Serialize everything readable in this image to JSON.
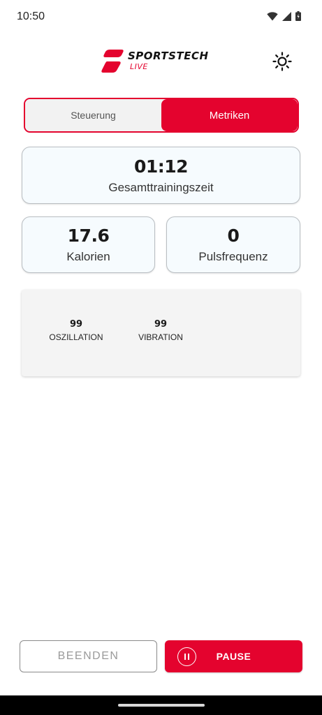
{
  "status_bar": {
    "time": "10:50",
    "icons": [
      "wifi-icon",
      "cell-signal-icon",
      "battery-icon"
    ]
  },
  "header": {
    "brand": "SPORTSTECH",
    "sub": "LIVE",
    "theme_icon": "sun-icon"
  },
  "tabs": [
    {
      "label": "Steuerung",
      "active": false
    },
    {
      "label": "Metriken",
      "active": true
    }
  ],
  "metrics": {
    "training_time": {
      "value": "01:12",
      "label": "Gesamttrainingszeit"
    },
    "calories": {
      "value": "17.6",
      "label": "Kalorien"
    },
    "pulse": {
      "value": "0",
      "label": "Pulsfrequenz"
    }
  },
  "extra": {
    "oscillation": {
      "value": "99",
      "label": "OSZILLATION"
    },
    "vibration": {
      "value": "99",
      "label": "VIBRATION"
    }
  },
  "actions": {
    "end_label": "BEENDEN",
    "pause_label": "PAUSE",
    "pause_icon": "pause-circle-icon"
  },
  "colors": {
    "accent": "#e4032e",
    "card_bg": "#f6fbfe",
    "card_border": "#b9bec2",
    "panel_bg": "#f4f4f4"
  }
}
